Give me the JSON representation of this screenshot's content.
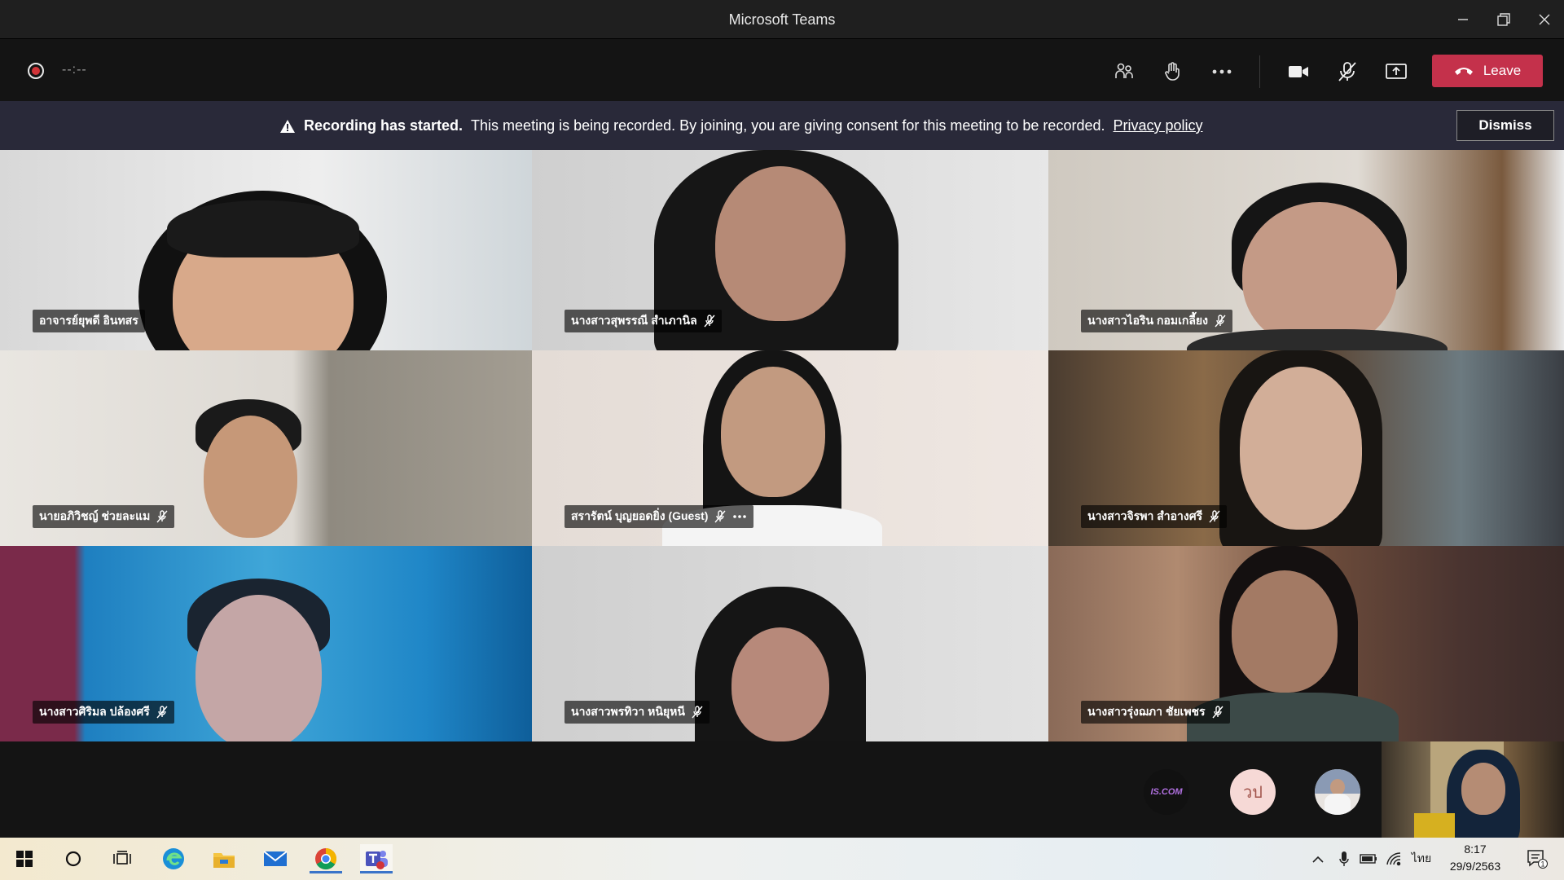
{
  "window": {
    "title": "Microsoft Teams"
  },
  "toolbar": {
    "timer": "--:--",
    "leave_label": "Leave"
  },
  "banner": {
    "strong": "Recording has started.",
    "text": "This meeting is being recorded. By joining, you are giving consent for this meeting to be recorded.",
    "link": "Privacy policy",
    "dismiss": "Dismiss"
  },
  "participants": [
    {
      "name": "อาจารย์ยุพดี อินทสร"
    },
    {
      "name": "นางสาวสุพรรณี สำเภานิล"
    },
    {
      "name": "นางสาวไอริน กอมเกลี้ยง"
    },
    {
      "name": "นายอภิวิชญ์ ช่วยละแม"
    },
    {
      "name": "สรารัตน์ บุญยอดยิ่ง (Guest)"
    },
    {
      "name": "นางสาวจิรพา สำอางศรี"
    },
    {
      "name": "นางสาวศิริมล ปล้องศรี"
    },
    {
      "name": "นางสาวพรทิวา หนิยุหนี"
    },
    {
      "name": "นางสาวรุ่งฌภา ชัยเพชร"
    }
  ],
  "strip": {
    "avatar1_text": "IS.COM",
    "avatar2_initials": "วป"
  },
  "taskbar": {
    "language": "ไทย",
    "time": "8:17",
    "date": "29/9/2563",
    "notification_count": "1"
  },
  "colors": {
    "leave": "#c4314b",
    "banner_bg": "#292939",
    "recording": "#d13438"
  }
}
